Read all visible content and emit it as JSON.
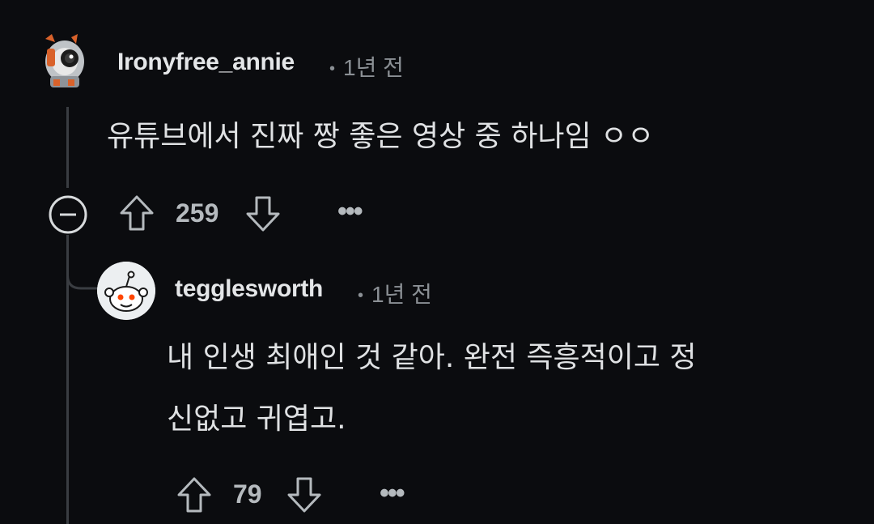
{
  "comments": [
    {
      "username": "Ironyfree_annie",
      "time": "1년 전",
      "text": "유튜브에서 진짜 짱 좋은 영상 중 하나임 ㅇㅇ",
      "score": "259"
    },
    {
      "username": "tegglesworth",
      "time": "1년 전",
      "text_line1": "내 인생 최애인 것 같아. 완전 즉흥적이고 정",
      "text_line2": "신없고 귀엽고.",
      "score": "79"
    }
  ],
  "icons": {
    "collapse": "minus-circle-icon",
    "upvote": "arrow-up-icon",
    "downvote": "arrow-down-icon",
    "more": "ellipsis-icon"
  },
  "colors": {
    "background": "#0b0c0f",
    "text": "#dfe1e3",
    "muted": "#8b9095"
  }
}
